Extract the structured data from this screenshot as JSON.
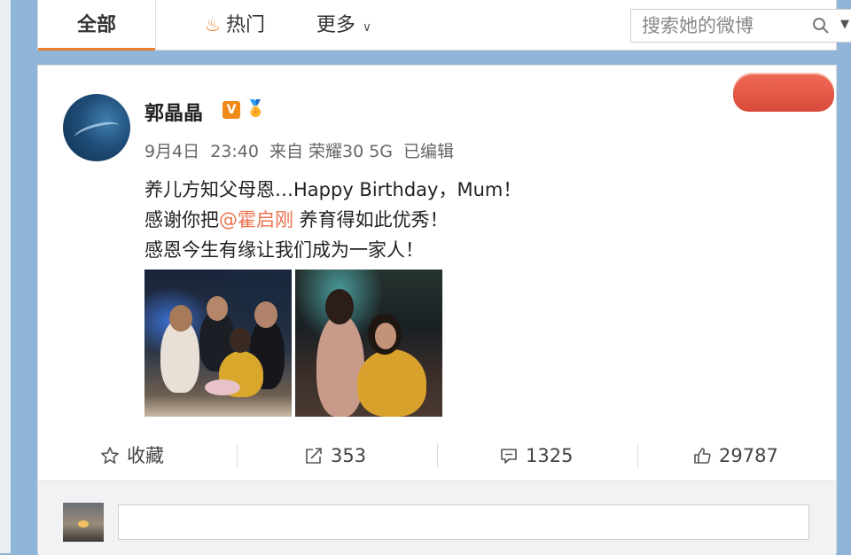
{
  "tabs": {
    "all": "全部",
    "hot": "热门",
    "more": "更多"
  },
  "search": {
    "placeholder": "搜索她的微博"
  },
  "post": {
    "username": "郭晶晶",
    "verified_mark": "V",
    "meta": {
      "date": "9月4日",
      "time": "23:40",
      "source": "来自 荣耀30 5G",
      "edited": "已编辑"
    },
    "lines": {
      "l1": "养儿方知父母恩…Happy Birthday，Mum！",
      "l2_before": "感谢你把",
      "l2_mention": "@霍启刚",
      "l2_after": " 养育得如此优秀！",
      "l3": "感恩今生有缘让我们成为一家人！"
    },
    "actions": {
      "favorite": "收藏",
      "repost": "353",
      "comment": "1325",
      "like": "29787"
    }
  },
  "colors": {
    "accent": "#e8802d",
    "mention": "#eb7350",
    "background": "#8fb6d8"
  },
  "icons": [
    "flame-icon",
    "chevron-down-icon",
    "search-icon",
    "star-icon",
    "repost-icon",
    "comment-icon",
    "thumbs-up-icon",
    "verified-badge-icon",
    "medal-icon"
  ]
}
